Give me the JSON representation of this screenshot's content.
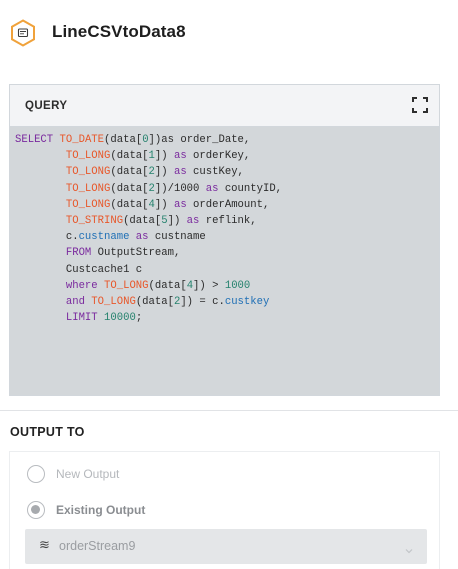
{
  "header": {
    "title": "LineCSVtoData8",
    "icon": "stream-hexagon-icon",
    "accent": "#f0a23b"
  },
  "query": {
    "label": "QUERY",
    "expand_icon": "fullscreen-icon",
    "lines": [
      [
        [
          "kw",
          "SELECT"
        ],
        [
          "t",
          " "
        ],
        [
          "fn",
          "TO_DATE"
        ],
        [
          "t",
          "(data["
        ],
        [
          "num",
          "0"
        ],
        [
          "t",
          "])as order_Date,"
        ]
      ],
      [
        [
          "t",
          "        "
        ],
        [
          "fn",
          "TO_LONG"
        ],
        [
          "t",
          "(data["
        ],
        [
          "num",
          "1"
        ],
        [
          "t",
          "]) "
        ],
        [
          "kw",
          "as"
        ],
        [
          "t",
          " orderKey,"
        ]
      ],
      [
        [
          "t",
          "        "
        ],
        [
          "fn",
          "TO_LONG"
        ],
        [
          "t",
          "(data["
        ],
        [
          "num",
          "2"
        ],
        [
          "t",
          "]) "
        ],
        [
          "kw",
          "as"
        ],
        [
          "t",
          " custKey,"
        ]
      ],
      [
        [
          "t",
          "        "
        ],
        [
          "fn",
          "TO_LONG"
        ],
        [
          "t",
          "(data["
        ],
        [
          "num",
          "2"
        ],
        [
          "t",
          "])/1000 "
        ],
        [
          "kw",
          "as"
        ],
        [
          "t",
          " countyID,"
        ]
      ],
      [
        [
          "t",
          "        "
        ],
        [
          "fn",
          "TO_LONG"
        ],
        [
          "t",
          "(data["
        ],
        [
          "num",
          "4"
        ],
        [
          "t",
          "]) "
        ],
        [
          "kw",
          "as"
        ],
        [
          "t",
          " orderAmount,"
        ]
      ],
      [
        [
          "t",
          "        "
        ],
        [
          "fn",
          "TO_STRING"
        ],
        [
          "t",
          "(data["
        ],
        [
          "num",
          "5"
        ],
        [
          "t",
          "]) "
        ],
        [
          "kw",
          "as"
        ],
        [
          "t",
          " reflink,"
        ]
      ],
      [
        [
          "t",
          "        c."
        ],
        [
          "prop",
          "custname"
        ],
        [
          "t",
          " "
        ],
        [
          "kw",
          "as"
        ],
        [
          "t",
          " custname"
        ]
      ],
      [
        [
          "t",
          "        "
        ],
        [
          "kw",
          "FROM"
        ],
        [
          "t",
          " OutputStream,"
        ]
      ],
      [
        [
          "t",
          "        Custcache1 c"
        ]
      ],
      [
        [
          "t",
          "        "
        ],
        [
          "kw",
          "where"
        ],
        [
          "t",
          " "
        ],
        [
          "fn",
          "TO_LONG"
        ],
        [
          "t",
          "(data["
        ],
        [
          "num",
          "4"
        ],
        [
          "t",
          "]) > "
        ],
        [
          "num",
          "1000"
        ]
      ],
      [
        [
          "t",
          "        "
        ],
        [
          "kw",
          "and"
        ],
        [
          "t",
          " "
        ],
        [
          "fn",
          "TO_LONG"
        ],
        [
          "t",
          "(data["
        ],
        [
          "num",
          "2"
        ],
        [
          "t",
          "]) = c."
        ],
        [
          "prop",
          "custkey"
        ]
      ],
      [
        [
          "t",
          "        "
        ],
        [
          "kw",
          "LIMIT"
        ],
        [
          "t",
          " "
        ],
        [
          "num",
          "10000"
        ],
        [
          "t",
          ";"
        ]
      ]
    ]
  },
  "output": {
    "label": "OUTPUT TO",
    "options": [
      {
        "label": "New Output",
        "selected": false
      },
      {
        "label": "Existing Output",
        "selected": true
      }
    ],
    "select": {
      "icon": "stream-icon",
      "value": "orderStream9"
    }
  }
}
